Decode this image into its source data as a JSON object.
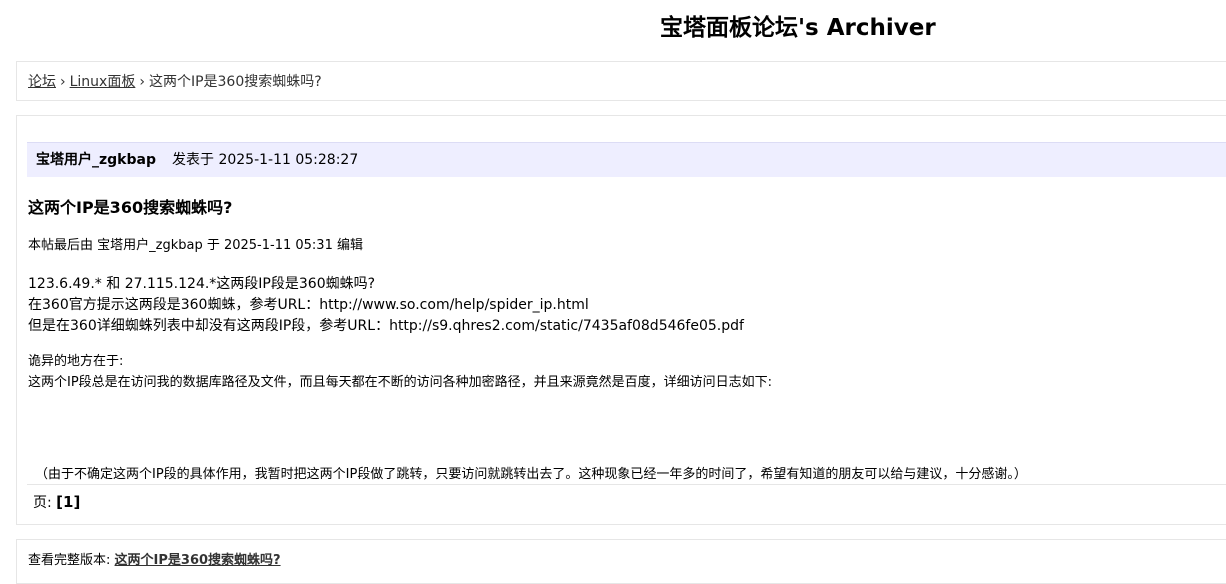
{
  "header": {
    "site_title": "宝塔面板论坛's Archiver"
  },
  "breadcrumb": {
    "home": "论坛",
    "separator_1": "›",
    "forum": "Linux面板",
    "separator_2": "›",
    "current": "这两个IP是360搜索蜘蛛吗?"
  },
  "post": {
    "author": "宝塔用户_zgkbap",
    "posted_label": "发表于 2025-1-11 05:28:27",
    "title": "这两个IP是360搜索蜘蛛吗?",
    "edit_note": "本帖最后由 宝塔用户_zgkbap 于 2025-1-11 05:31 编辑",
    "lines": [
      "123.6.49.* 和 27.115.124.*这两段IP段是360蜘蛛吗?",
      "在360官方提示这两段是360蜘蛛，参考URL：http://www.so.com/help/spider_ip.html",
      "但是在360详细蜘蛛列表中却没有这两段IP段，参考URL：http://s9.qhres2.com/static/7435af08d546fe05.pdf",
      "诡异的地方在于:",
      "这两个IP段总是在访问我的数据库路径及文件，而且每天都在不断的访问各种加密路径，并且来源竟然是百度，详细访问日志如下:",
      "（由于不确定这两个IP段的具体作用，我暂时把这两个IP段做了跳转，只要访问就跳转出去了。这种现象已经一年多的时间了，希望有知道的朋友可以给与建议，十分感谢。）"
    ]
  },
  "pager": {
    "label": "页:",
    "current_page": "[1]"
  },
  "footer": {
    "label": "查看完整版本:",
    "link_text": "这两个IP是360搜索蜘蛛吗?"
  }
}
